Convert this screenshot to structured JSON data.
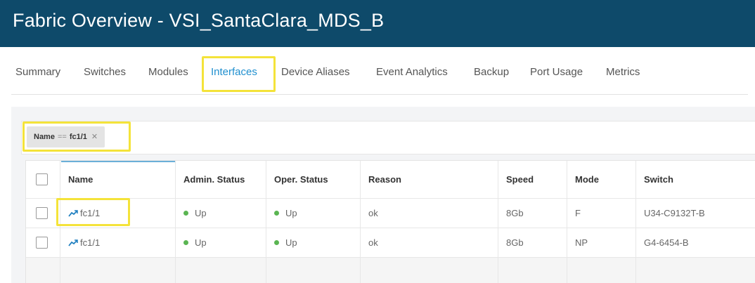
{
  "header": {
    "title": "Fabric Overview - VSI_SantaClara_MDS_B"
  },
  "tabs": [
    {
      "label": "Summary"
    },
    {
      "label": "Switches"
    },
    {
      "label": "Modules"
    },
    {
      "label": "Interfaces",
      "active": true
    },
    {
      "label": "Device Aliases"
    },
    {
      "label": "Event Analytics"
    },
    {
      "label": "Backup"
    },
    {
      "label": "Port Usage"
    },
    {
      "label": "Metrics"
    }
  ],
  "filter": {
    "key": "Name",
    "operator": "==",
    "value": "fc1/1",
    "remove_icon": "close-icon"
  },
  "table": {
    "columns": [
      "Name",
      "Admin. Status",
      "Oper. Status",
      "Reason",
      "Speed",
      "Mode",
      "Switch"
    ],
    "rows": [
      {
        "name": "fc1/1",
        "admin_status": "Up",
        "oper_status": "Up",
        "reason": "ok",
        "speed": "8Gb",
        "mode": "F",
        "switch": "U34-C9132T-B"
      },
      {
        "name": "fc1/1",
        "admin_status": "Up",
        "oper_status": "Up",
        "reason": "ok",
        "speed": "8Gb",
        "mode": "NP",
        "switch": "G4-6454-B"
      }
    ]
  },
  "colors": {
    "header_bg": "#0e4a6a",
    "active_tab": "#1f8fcf",
    "status_up": "#5ab552",
    "highlight": "#f4e33a",
    "trend_icon": "#1f7fc0"
  }
}
